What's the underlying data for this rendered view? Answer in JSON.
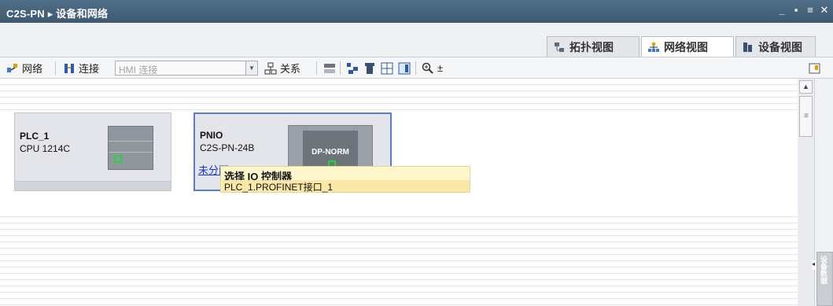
{
  "window": {
    "title": "C2S-PN ▸ 设备和网络",
    "controls": [
      "_",
      "▪",
      "≡",
      "✕"
    ]
  },
  "view_tabs": [
    {
      "label": "拓扑视图",
      "icon": "topology-icon",
      "active": false
    },
    {
      "label": "网络视图",
      "icon": "network-icon",
      "active": true
    },
    {
      "label": "设备视图",
      "icon": "device-icon",
      "active": false
    }
  ],
  "toolbar": {
    "network_label": "网络",
    "connect_label": "连接",
    "connection_type_placeholder": "HMI 连接",
    "relation_label": "关系",
    "zoom_label": "±"
  },
  "devices": [
    {
      "name": "PLC_1",
      "type": "CPU 1214C"
    },
    {
      "name": "PNIO",
      "type": "C2S-PN-24B",
      "module_label": "DP-NORM",
      "link_text": "未分配"
    }
  ],
  "tooltip": {
    "title": "选择 IO 控制器",
    "option": "PLC_1.PROFINET接口_1"
  },
  "side_panel": {
    "label": "设备数据"
  },
  "colors": {
    "titlebar": "#3e5a72",
    "device_bg": "#e3e5ea",
    "selected_border": "#5a7fc8",
    "link": "#1e39d8",
    "tooltip_bg": "#fff7cc",
    "led": "#27d23a"
  }
}
